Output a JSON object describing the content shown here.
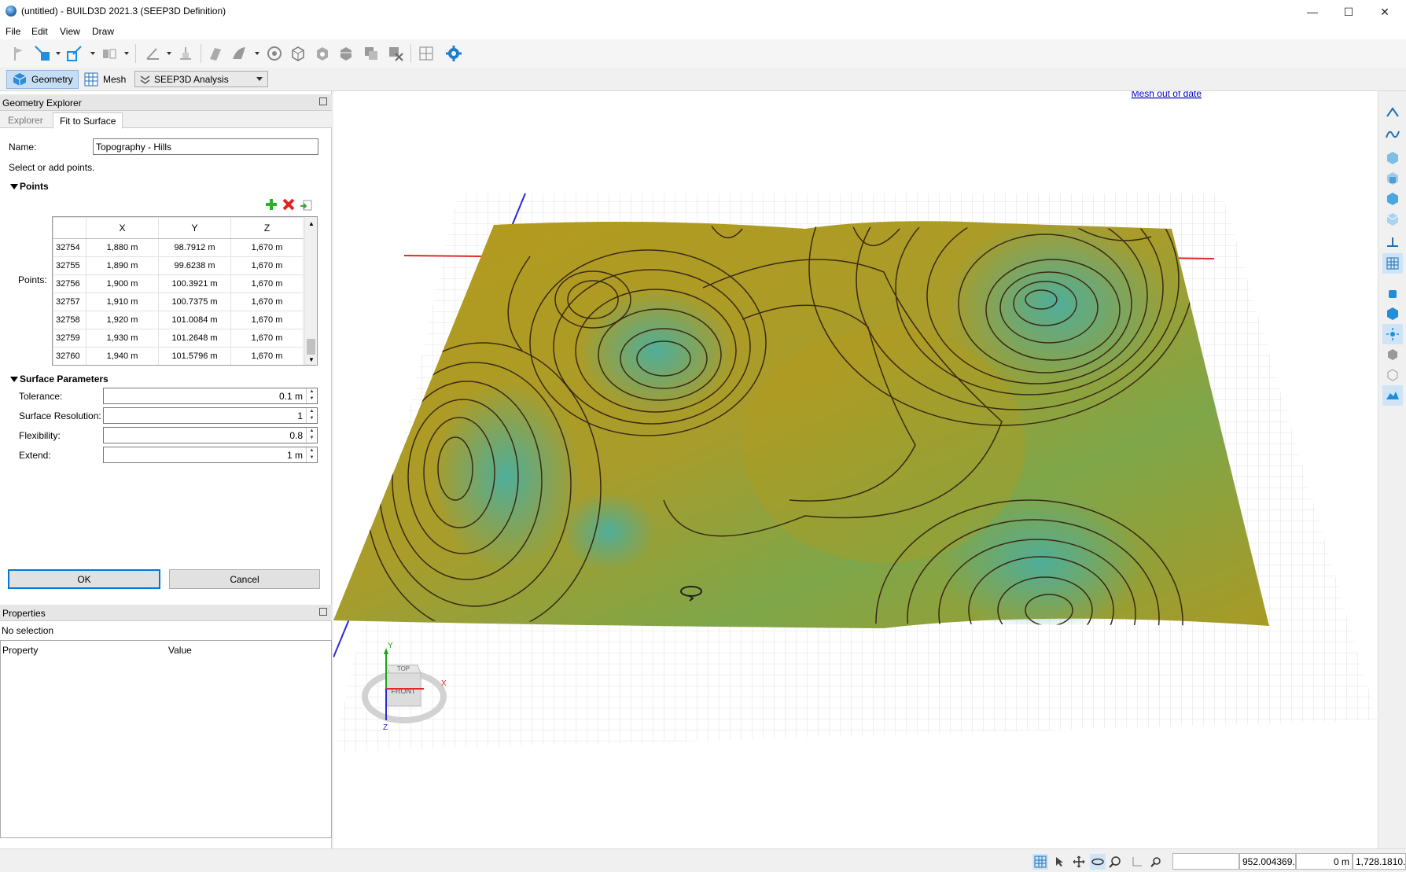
{
  "window": {
    "title": "(untitled) - BUILD3D 2021.3 (SEEP3D Definition)",
    "minimize": "—",
    "maximize": "☐",
    "close": "✕"
  },
  "menu": [
    "File",
    "Edit",
    "View",
    "Draw"
  ],
  "modes": {
    "geometry": "Geometry",
    "mesh": "Mesh",
    "analysis": "SEEP3D Analysis"
  },
  "geometry_explorer": {
    "header": "Geometry Explorer",
    "tabs": [
      "Explorer",
      "Fit to Surface"
    ],
    "name_label": "Name:",
    "name_value": "Topography - Hills",
    "hint": "Select or add points.",
    "points_section": "Points",
    "points_label": "Points:",
    "columns": [
      "X",
      "Y",
      "Z"
    ],
    "rows": [
      {
        "id": "32754",
        "x": "1,880 m",
        "y": "98.7912 m",
        "z": "1,670 m"
      },
      {
        "id": "32755",
        "x": "1,890 m",
        "y": "99.6238 m",
        "z": "1,670 m"
      },
      {
        "id": "32756",
        "x": "1,900 m",
        "y": "100.3921 m",
        "z": "1,670 m"
      },
      {
        "id": "32757",
        "x": "1,910 m",
        "y": "100.7375 m",
        "z": "1,670 m"
      },
      {
        "id": "32758",
        "x": "1,920 m",
        "y": "101.0084 m",
        "z": "1,670 m"
      },
      {
        "id": "32759",
        "x": "1,930 m",
        "y": "101.2648 m",
        "z": "1,670 m"
      },
      {
        "id": "32760",
        "x": "1,940 m",
        "y": "101.5796 m",
        "z": "1,670 m"
      }
    ],
    "surface_section": "Surface Parameters",
    "params": [
      {
        "label": "Tolerance:",
        "value": "0.1 m"
      },
      {
        "label": "Surface Resolution:",
        "value": "1"
      },
      {
        "label": "Flexibility:",
        "value": "0.8"
      },
      {
        "label": "Extend:",
        "value": "1 m"
      }
    ],
    "ok": "OK",
    "cancel": "Cancel"
  },
  "properties": {
    "header": "Properties",
    "selection": "No selection",
    "col_property": "Property",
    "col_value": "Value"
  },
  "viewport": {
    "mesh_status": "Mesh out of date",
    "cube_top": "TOP",
    "cube_front": "FRONT",
    "axis_x": "X",
    "axis_y": "Y",
    "axis_z": "Z",
    "colors": {
      "surface_low": "#b59a1c",
      "surface_high": "#4fae9a",
      "contour": "#3a2a14",
      "grid": "#e3e3e3"
    }
  },
  "status": {
    "field1": "",
    "field2": "952.004369...",
    "field3": "0 m",
    "field4": "1,728.1810..."
  }
}
